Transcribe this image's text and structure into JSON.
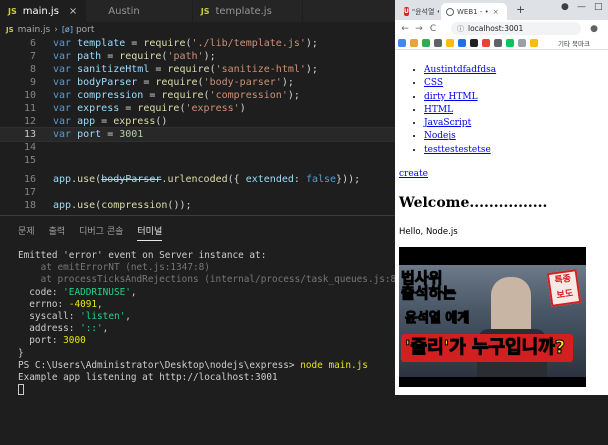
{
  "editor": {
    "tabs": [
      {
        "icon": "JS",
        "label": "main.js",
        "close": "×"
      },
      {
        "icon": "",
        "label": "Austin",
        "close": ""
      },
      {
        "icon": "JS",
        "label": "template.js",
        "close": ""
      }
    ],
    "breadcrumb": {
      "file_icon": "JS",
      "file": "main.js",
      "sep": "›",
      "symbol_icon": "[ø]",
      "symbol": "port"
    },
    "line_numbers": [
      "6",
      "7",
      "8",
      "9",
      "10",
      "11",
      "12",
      "13",
      "14",
      "15",
      "16",
      "17",
      "18"
    ]
  },
  "panel": {
    "tabs": [
      "문제",
      "출력",
      "디버그 콘솔",
      "터미널"
    ],
    "active_tab": "터미널"
  },
  "terminal": {
    "l1": "Emitted 'error' event on Server instance at:",
    "l2": "    at emitErrorNT (net.js:1347:8)",
    "l3": "    at processTicksAndRejections (internal/process/task_queues.js:82",
    "l4_key": "  code: ",
    "l4_val": "'EADDRINUSE'",
    "l4_end": ",",
    "l5_key": "  errno: ",
    "l5_val": "-4091",
    "l5_end": ",",
    "l6_key": "  syscall: ",
    "l6_val": "'listen'",
    "l6_end": ",",
    "l7_key": "  address: ",
    "l7_val": "'::'",
    "l7_end": ",",
    "l8_key": "  port: ",
    "l8_val": "3000",
    "l9": "}",
    "l10_prompt": "PS C:\\Users\\Administrator\\Desktop\\nodejs\\express> ",
    "l10_cmd": "node main.js",
    "l11": "Example app listening at http://localhost:3001"
  },
  "browser": {
    "tab1_icon": "U",
    "tab1_label": "\"윤석열 •",
    "tab1_close": "×",
    "tab2_label": "WEB1 - •",
    "tab2_close": "×",
    "new_tab": "+",
    "window_controls": [
      "●",
      "—",
      "□"
    ],
    "back": "←",
    "forward": "→",
    "reload": "C",
    "url": "localhost:3001",
    "url_icon": "ⓘ",
    "bookmarks_other": "기타 북마크"
  },
  "page": {
    "nav_items": [
      "Austintdfadfdsa",
      "CSS",
      "dirty HTML",
      "HTML",
      "JavaScript",
      "Nodejs",
      "testtestestetse"
    ],
    "create": "create",
    "heading": "Welcome................",
    "body": "Hello, Node.js",
    "thumbnail": {
      "caption1": "법사위",
      "caption2": "출석하는",
      "caption3": "윤석열 에게",
      "caption4": "'줄리'가 누구입니까?",
      "stamp": "특종 보도"
    }
  }
}
